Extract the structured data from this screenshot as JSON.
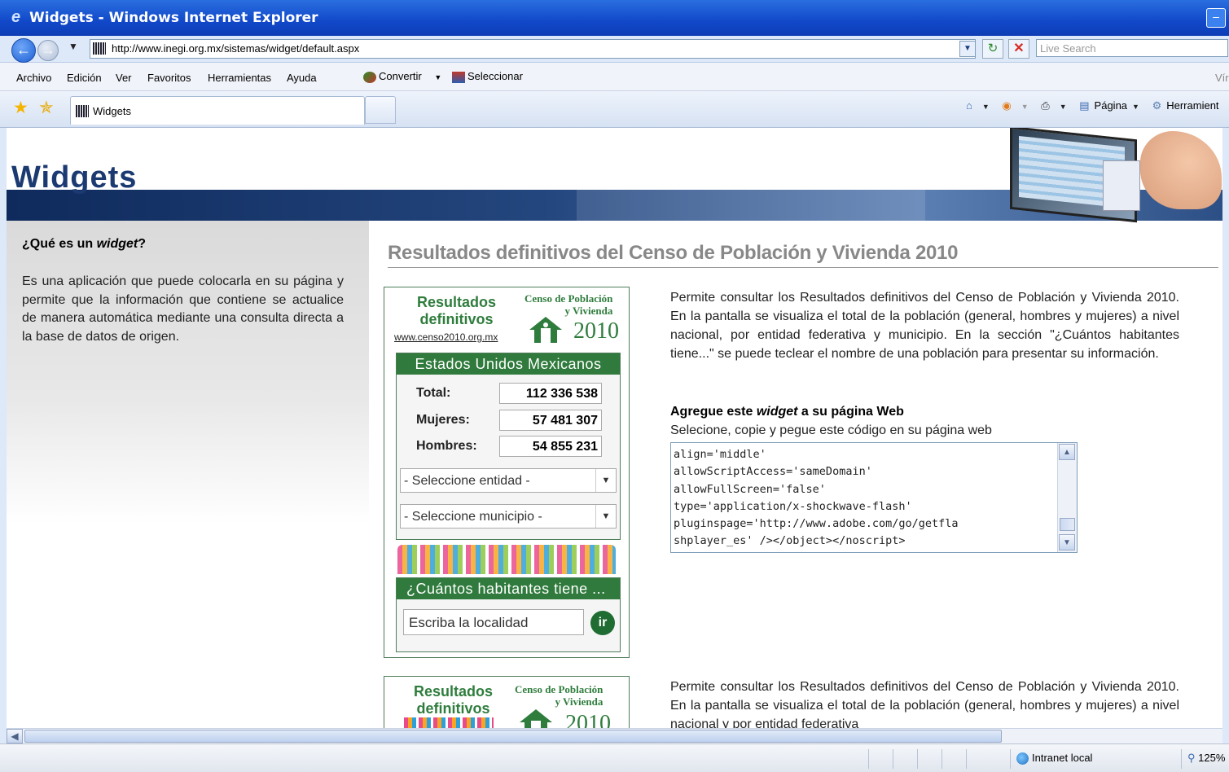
{
  "window": {
    "title": "Widgets - Windows Internet Explorer",
    "minimize": "–"
  },
  "address": {
    "url": "http://www.inegi.org.mx/sistemas/widget/default.aspx",
    "search_placeholder": "Live Search"
  },
  "menu": {
    "items": [
      "Archivo",
      "Edición",
      "Ver",
      "Favoritos",
      "Herramientas",
      "Ayuda"
    ],
    "convertir": "Convertir",
    "seleccionar": "Seleccionar",
    "right_cut": "Vír"
  },
  "tabs": {
    "active_label": "Widgets"
  },
  "commands": {
    "pagina": "Página",
    "herramientas": "Herramient"
  },
  "banner": {
    "title": "Widgets"
  },
  "sidebar": {
    "heading_pre": "¿Qué es un ",
    "heading_em": "widget",
    "heading_post": "?",
    "text": "Es una aplicación que puede colocarla en su página y permite que la información que contiene se actualice de manera automática mediante una consulta directa a la base de datos de origen."
  },
  "main": {
    "title": "Resultados definitivos del Censo de Población y Vivienda 2010"
  },
  "widget": {
    "resultados": "Resultados",
    "definitivos": "definitivos",
    "url": "www.censo2010.org.mx",
    "censo_line1": "Censo de Población",
    "censo_line2": "y Vivienda",
    "year": "2010",
    "region_header": "Estados Unidos Mexicanos",
    "total_label": "Total:",
    "total_value": "112 336 538",
    "mujeres_label": "Mujeres:",
    "mujeres_value": "57 481 307",
    "hombres_label": "Hombres:",
    "hombres_value": "54 855 231",
    "entidad_select": "- Seleccione entidad -",
    "municipio_select": "- Seleccione municipio -",
    "habitantes_header": "¿Cuántos habitantes tiene ...",
    "localidad_placeholder": "Escriba la localidad",
    "go_button": "ir"
  },
  "description1": "Permite consultar los Resultados definitivos del Censo de Población y Vivienda 2010. En la pantalla se visualiza el total de la población (general, hombres y mujeres) a nivel nacional, por entidad federativa y municipio. En la sección \"¿Cuántos habitantes tiene...\" se puede teclear el nombre de una población para presentar su información.",
  "add_widget": {
    "heading_pre": "Agregue este ",
    "heading_em": "widget",
    "heading_post": " a su página Web",
    "sub": "Selecione, copie y pegue este código en su página web",
    "code": "align='middle'\nallowScriptAccess='sameDomain'\nallowFullScreen='false'\ntype='application/x-shockwave-flash'\npluginspage='http://www.adobe.com/go/getfla\nshplayer_es' /></object></noscript>"
  },
  "widget2": {
    "resultados": "Resultados",
    "definitivos": "definitivos",
    "censo_line1": "Censo de Población",
    "censo_line2": "y Vivienda",
    "year": "2010"
  },
  "description2": "Permite consultar los Resultados definitivos del Censo de Población y Vivienda 2010. En la pantalla se visualiza el total de la población (general, hombres y mujeres) a nivel nacional y por entidad federativa",
  "status": {
    "zone": "Intranet local",
    "zoom": "125%"
  }
}
